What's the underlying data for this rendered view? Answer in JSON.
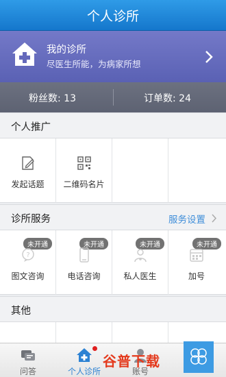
{
  "titlebar": {
    "title": "个人诊所"
  },
  "header": {
    "title": "我的诊所",
    "subtitle": "尽医生所能，为病家所想"
  },
  "stats": {
    "fans": "粉丝数: 13",
    "orders": "订单数: 24"
  },
  "promo": {
    "title": "个人推广",
    "items": [
      {
        "label": "发起话题",
        "icon": "edit-icon"
      },
      {
        "label": "二维码名片",
        "icon": "qr-code-icon"
      }
    ]
  },
  "services": {
    "title": "诊所服务",
    "settings_link": "服务设置",
    "items": [
      {
        "label": "图文咨询",
        "badge": "未开通",
        "icon": "chat-icon"
      },
      {
        "label": "电话咨询",
        "badge": "未开通",
        "icon": "phone-icon"
      },
      {
        "label": "私人医生",
        "badge": "未开通",
        "icon": "doctor-icon"
      },
      {
        "label": "加号",
        "badge": "未开通",
        "icon": "calendar-icon"
      }
    ]
  },
  "other": {
    "title": "其他"
  },
  "tabbar": {
    "tabs": [
      {
        "label": "问答",
        "icon": "qa-icon"
      },
      {
        "label": "个人诊所",
        "icon": "clinic-icon",
        "active": true
      },
      {
        "label": "账号",
        "icon": "account-icon"
      }
    ]
  },
  "watermark": {
    "text": "谷普下载"
  },
  "colors": {
    "titlebar": "#1e88dd",
    "header": "#656bbf",
    "link": "#3f8ed9"
  }
}
